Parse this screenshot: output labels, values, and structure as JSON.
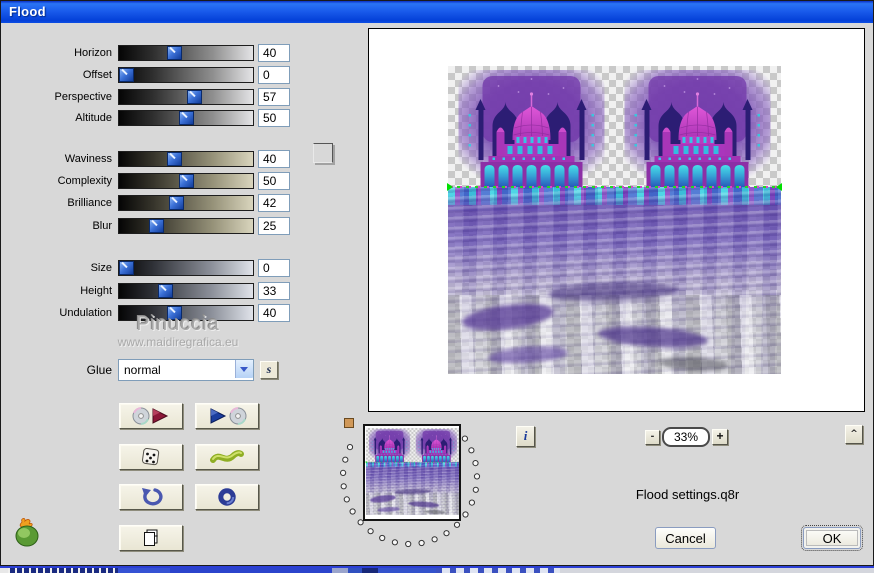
{
  "window": {
    "title": "Flood"
  },
  "panel": {
    "sliders": [
      {
        "label": "Horizon",
        "value": "40"
      },
      {
        "label": "Offset",
        "value": "0"
      },
      {
        "label": "Perspective",
        "value": "57"
      },
      {
        "label": "Altitude",
        "value": "50"
      },
      {
        "label": "Waviness",
        "value": "40"
      },
      {
        "label": "Complexity",
        "value": "50"
      },
      {
        "label": "Brilliance",
        "value": "42"
      },
      {
        "label": "Blur",
        "value": "25"
      },
      {
        "label": "Size",
        "value": "0"
      },
      {
        "label": "Height",
        "value": "33"
      },
      {
        "label": "Undulation",
        "value": "40"
      }
    ],
    "glue": {
      "label": "Glue",
      "value": "normal",
      "shuffle_label": "s"
    },
    "swatch_color": "#000000",
    "watermark": {
      "line1": "Pinuccia",
      "line2": "www.maidiregrafica.eu"
    }
  },
  "preview": {
    "zoom": {
      "minus_label": "-",
      "value": "33%",
      "plus_label": "+"
    },
    "info_label": "i",
    "collapse_label": "^",
    "settings_filename": "Flood settings.q8r"
  },
  "actions": {
    "cancel_label": "Cancel",
    "ok_label": "OK"
  },
  "icons": [
    "cd-save-icon",
    "cd-load-icon",
    "dice-random-icon",
    "wave-style-icon",
    "undo-icon",
    "ring-reset-icon",
    "copy-pages-icon",
    "flaming-pear-logo",
    "info-icon",
    "glue-shuffle-icon"
  ]
}
